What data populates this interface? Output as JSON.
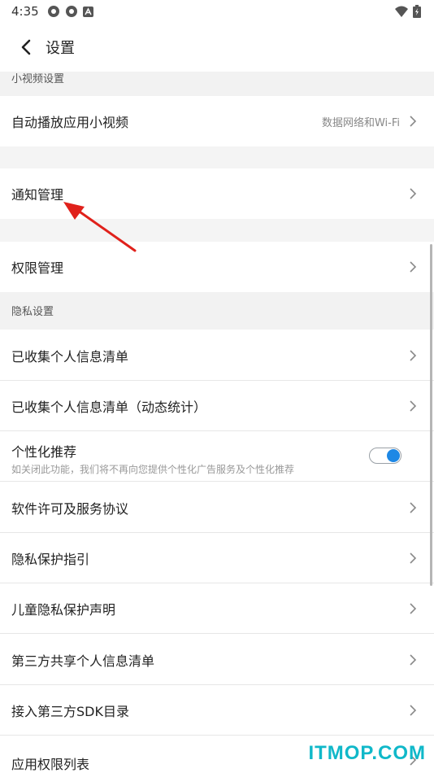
{
  "status_bar": {
    "time": "4:35"
  },
  "header": {
    "title": "设置"
  },
  "sections": {
    "small_video": "小视频设置",
    "privacy": "隐私设置"
  },
  "rows": {
    "autoplay": {
      "label": "自动播放应用小视频",
      "value": "数据网络和Wi-Fi"
    },
    "notifications": {
      "label": "通知管理"
    },
    "permissions": {
      "label": "权限管理"
    },
    "collected_info": {
      "label": "已收集个人信息清单"
    },
    "collected_info_dynamic": {
      "label": "已收集个人信息清单（动态统计）"
    },
    "personalized": {
      "label": "个性化推荐",
      "desc": "如关闭此功能，我们将不再向您提供个性化广告服务及个性化推荐",
      "enabled": true
    },
    "license": {
      "label": "软件许可及服务协议"
    },
    "privacy_guide": {
      "label": "隐私保护指引"
    },
    "child_privacy": {
      "label": "儿童隐私保护声明"
    },
    "third_party_share": {
      "label": "第三方共享个人信息清单"
    },
    "third_party_sdk": {
      "label": "接入第三方SDK目录"
    },
    "app_permissions": {
      "label": "应用权限列表"
    }
  },
  "watermark": "ITMOP.COM",
  "colors": {
    "toggle_on": "#1e88e5",
    "annotation": "#e0211b",
    "watermark": "#10b8c9"
  }
}
